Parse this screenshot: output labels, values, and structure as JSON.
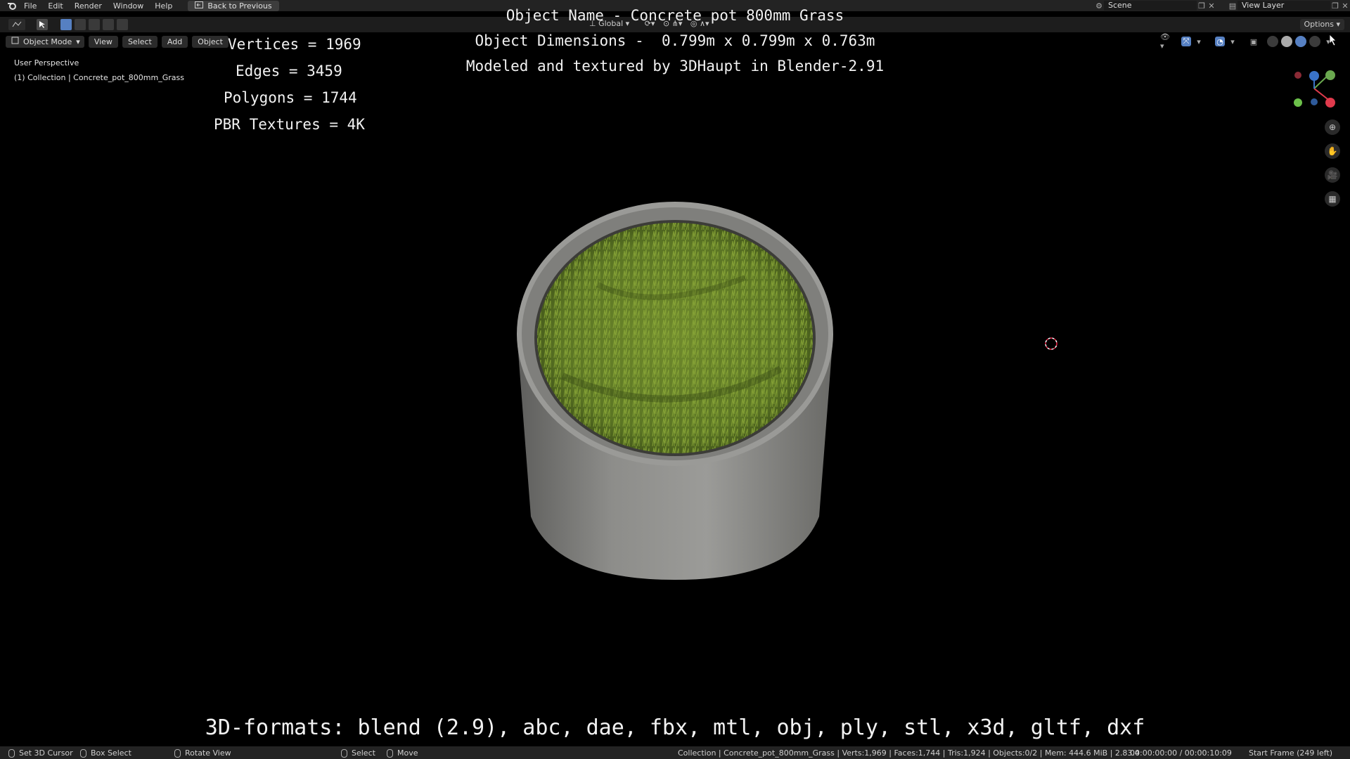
{
  "menubar": {
    "items": [
      "File",
      "Edit",
      "Render",
      "Window",
      "Help"
    ],
    "back_button": "Back to Previous",
    "scene_label": "Scene",
    "view_layer_label": "View Layer"
  },
  "toolbar": {
    "transform_orientation": "Global",
    "options_label": "Options"
  },
  "viewport_header": {
    "mode": "Object Mode",
    "menus": [
      "View",
      "Select",
      "Add",
      "Object"
    ]
  },
  "viewport": {
    "perspective": "User Perspective",
    "collection": "(1) Collection | Concrete_pot_800mm_Grass"
  },
  "overlay_text": {
    "vertices": "Vertices = 1969",
    "edges": "Edges = 3459",
    "polygons": "Polygons = 1744",
    "textures": "PBR Textures = 4K",
    "object_name": "Object Name - Concrete pot 800mm Grass",
    "dimensions": "Object Dimensions -  0.799m x 0.799m x 0.763m",
    "credit": "Modeled and textured by 3DHaupt in Blender-2.91",
    "formats": "3D-formats: blend (2.9), abc, dae, fbx, mtl, obj, ply, stl, x3d, gltf, dxf"
  },
  "statusbar": {
    "left_items": [
      "Set 3D Cursor",
      "Box Select",
      "Rotate View",
      "Select",
      "Move"
    ],
    "stats": "Collection | Concrete_pot_800mm_Grass | Verts:1,969 | Faces:1,744 | Tris:1,924 | Objects:0/2 | Mem: 444.6 MiB | 2.83.4",
    "time": "00:00:00:00 / 00:00:10:09",
    "frame": "Start Frame (249 left)"
  },
  "colors": {
    "accent": "#5680c2",
    "panel": "#232323",
    "viewport_bg": "#000000"
  }
}
